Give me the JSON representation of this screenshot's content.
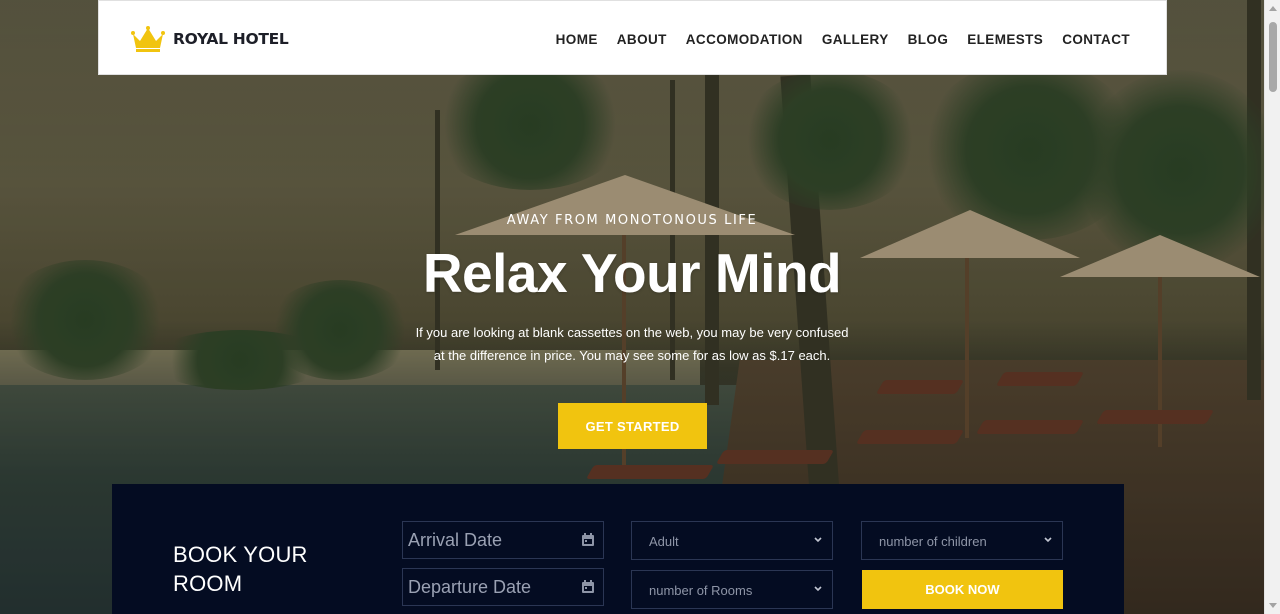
{
  "brand": {
    "name": "ROYAL HOTEL",
    "logo_icon": "crown-icon",
    "accent": "#f1c40f"
  },
  "nav": {
    "items": [
      "HOME",
      "ABOUT",
      "ACCOMODATION",
      "GALLERY",
      "BLOG",
      "ELEMESTS",
      "CONTACT"
    ]
  },
  "hero": {
    "eyebrow": "AWAY FROM MONOTONOUS LIFE",
    "title": "Relax Your Mind",
    "description_line1": "If you are looking at blank cassettes on the web, you may be very confused",
    "description_line2": "at the difference in price. You may see some for as low as $.17 each.",
    "cta_label": "GET STARTED"
  },
  "booking": {
    "title_line1": "BOOK YOUR",
    "title_line2": "ROOM",
    "arrival_placeholder": "Arrival Date",
    "departure_placeholder": "Departure Date",
    "adult_value": "Adult",
    "rooms_value": "number of Rooms",
    "children_value": "number of children",
    "submit_label": "BOOK NOW",
    "panel_color": "#040c22"
  }
}
